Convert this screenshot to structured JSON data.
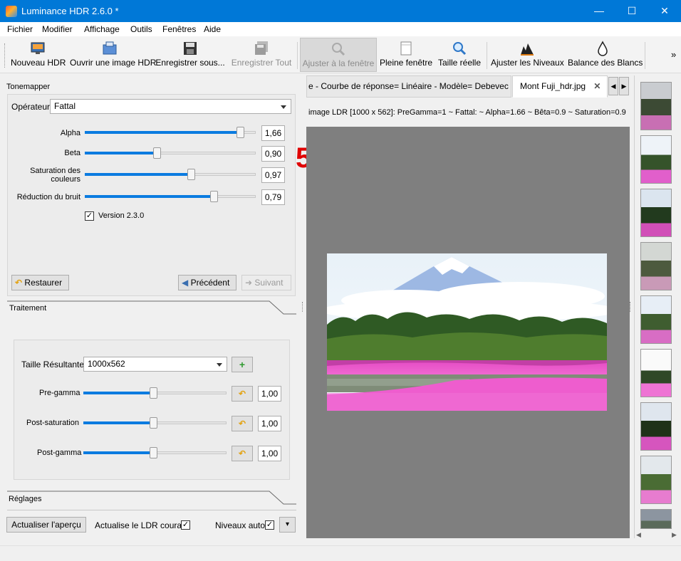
{
  "window": {
    "title": "Luminance HDR 2.6.0 *"
  },
  "menu": [
    "Fichier",
    "Modifier",
    "Affichage",
    "Outils",
    "Fenêtres",
    "Aide"
  ],
  "toolbar": {
    "new_hdr": "Nouveau HDR",
    "open_hdr": "Ouvrir une image HDR",
    "save_as": "Enregistrer sous...",
    "save_all": "Enregistrer Tout",
    "fit_window": "Ajuster à la fenêtre",
    "full_window": "Pleine fenêtre",
    "actual_size": "Taille réelle",
    "adjust_levels": "Ajuster les Niveaux",
    "white_balance": "Balance des Blancs",
    "overflow": "»"
  },
  "tonemapper": {
    "section_title": "Tonemapper",
    "operator_label": "Opérateur",
    "operator_value": "Fattal",
    "sliders": [
      {
        "label": "Alpha",
        "value": "1,66",
        "level": 0.93
      },
      {
        "label": "Beta",
        "value": "0,90",
        "level": 0.42
      },
      {
        "label": "Saturation des couleurs",
        "value": "0,97",
        "level": 0.63
      },
      {
        "label": "Réduction du bruit",
        "value": "0,79",
        "level": 0.77
      }
    ],
    "version_label": "Version 2.3.0",
    "version_checked": true,
    "restore_button": "Restaurer",
    "previous_button": "Précédent",
    "next_button": "Suivant"
  },
  "processing": {
    "section_title": "Traitement",
    "result_size_label": "Taille Résultante",
    "result_size_value": "1000x562",
    "sliders": [
      {
        "label": "Pre-gamma",
        "value": "1,00",
        "level": 0.49
      },
      {
        "label": "Post-saturation",
        "value": "1,00",
        "level": 0.49
      },
      {
        "label": "Post-gamma",
        "value": "1,00",
        "level": 0.49
      }
    ]
  },
  "settings": {
    "section_title": "Réglages",
    "update_preview_button": "Actualiser l'aperçu",
    "update_ldr_label": "Actualise le LDR courant",
    "update_ldr_checked": true,
    "auto_levels_label": "Niveaux auto",
    "auto_levels_checked": true
  },
  "annotation": {
    "number": "5",
    "color": "#e00000"
  },
  "tabs": [
    {
      "label": "e - Courbe de réponse= Linéaire - Modèle= Debevec",
      "active": false
    },
    {
      "label": "Mont Fuji_hdr.jpg",
      "active": true
    }
  ],
  "image_info": "image LDR [1000 x 562]: PreGamma=1 ~ Fattal: ~ Alpha=1.66 ~ Bêta=0.9 ~ Saturation=0.9",
  "icons": {
    "app": "luminance-app-icon",
    "close_tab": "✕",
    "check": "✓",
    "dropdown": "▾",
    "add": "+",
    "undo": "↶"
  }
}
